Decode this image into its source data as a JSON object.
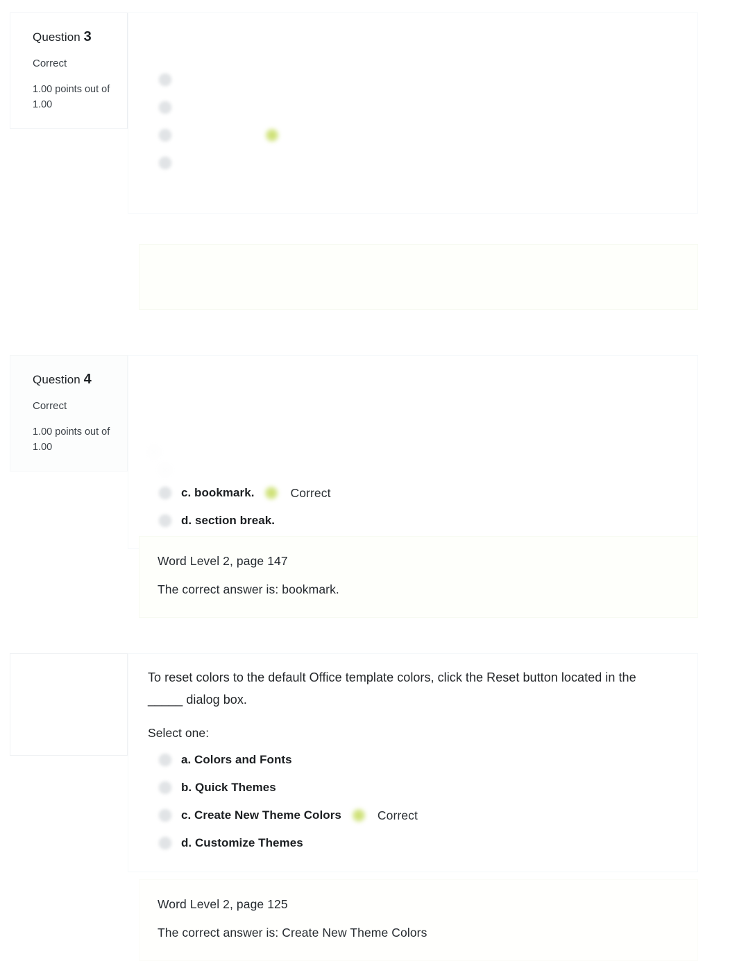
{
  "page": {
    "accent_correct": "#c8dc64",
    "background": "#ffffff",
    "panel_feedback_bg": "#fefffb"
  },
  "questions": [
    {
      "id": "q3",
      "number_label": "Question",
      "number": "3",
      "state": "Correct",
      "grade": "1.00 points out of 1.00",
      "text": "",
      "select_prompt": "",
      "options": [
        {
          "label": "",
          "marked_correct": false
        },
        {
          "label": "",
          "marked_correct": false
        },
        {
          "label": "",
          "marked_correct": true,
          "correct_text": ""
        },
        {
          "label": "",
          "marked_correct": false
        }
      ],
      "feedback": [
        "",
        ""
      ]
    },
    {
      "id": "q4",
      "number_label": "Question",
      "number": "4",
      "state": "Correct",
      "grade": "1.00 points out of 1.00",
      "text": "",
      "select_prompt": "",
      "options": [
        {
          "label": "",
          "marked_correct": false
        },
        {
          "label": "",
          "marked_correct": false
        },
        {
          "label": "c. bookmark.",
          "marked_correct": true,
          "correct_text": "Correct"
        },
        {
          "label": "d. section break.",
          "marked_correct": false
        }
      ],
      "feedback": [
        "Word Level 2, page 147",
        "The correct answer is: bookmark."
      ]
    },
    {
      "id": "q5",
      "number_label": "",
      "number": "",
      "state": "",
      "grade": "",
      "text": "To reset colors to the default Office template colors, click the Reset button located in the _____ dialog box.",
      "select_prompt": "Select one:",
      "options": [
        {
          "label": "a. Colors and Fonts",
          "marked_correct": false,
          "correct_text": ""
        },
        {
          "label": "b. Quick Themes",
          "marked_correct": false,
          "correct_text": ""
        },
        {
          "label": "c. Create New Theme Colors",
          "marked_correct": true,
          "correct_text": "Correct"
        },
        {
          "label": "d. Customize Themes",
          "marked_correct": false,
          "correct_text": ""
        }
      ],
      "feedback": [
        "Word Level 2, page 125",
        "The correct answer is: Create New Theme Colors"
      ]
    }
  ]
}
